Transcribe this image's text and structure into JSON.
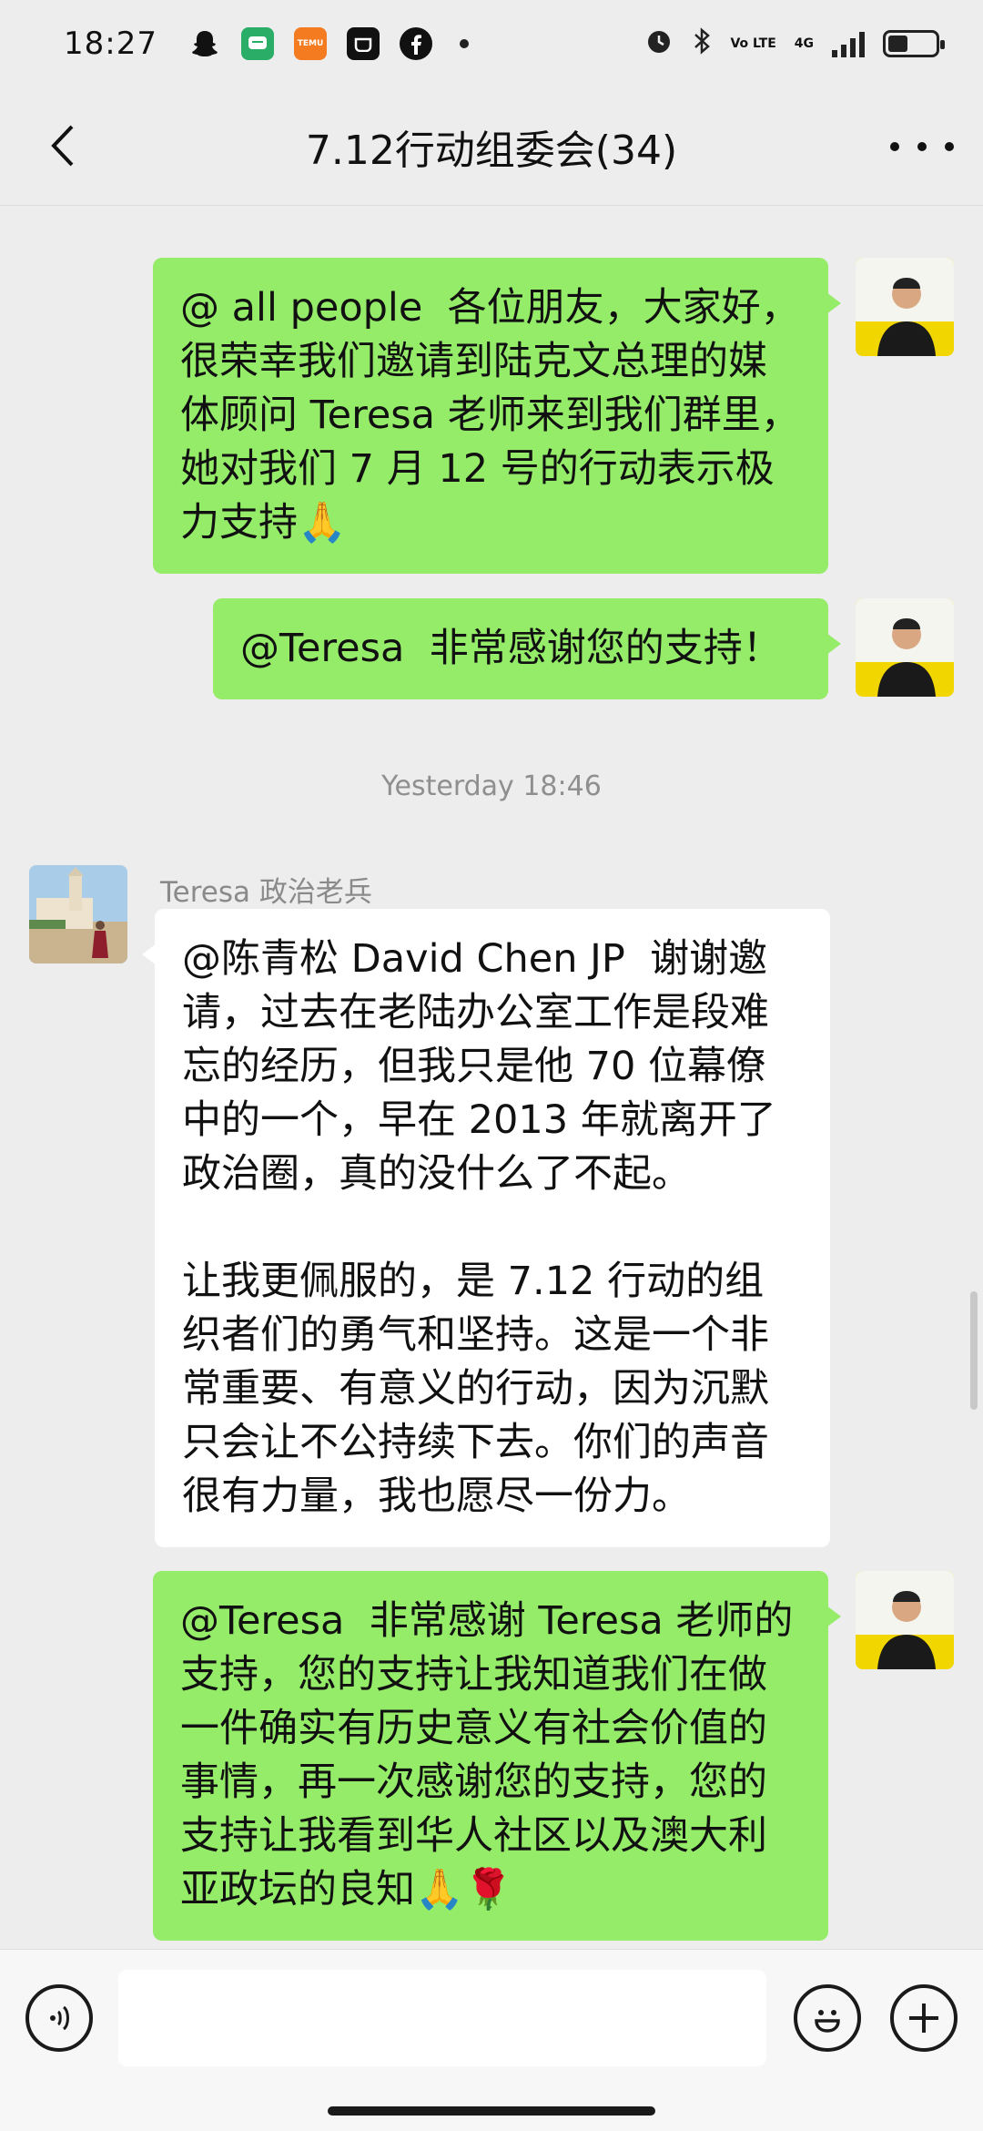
{
  "status_bar": {
    "time": "18:27",
    "apps": [
      "snapchat-icon",
      "wechat-icon",
      "temu-icon",
      "app-box-icon",
      "facebook-icon"
    ],
    "temu_label": "TEMU",
    "network": "4G",
    "volte": "Vo LTE"
  },
  "header": {
    "title": "7.12行动组委会(34)"
  },
  "messages": [
    {
      "direction": "out",
      "text": "@ all people  各位朋友，大家好，很荣幸我们邀请到陆克文总理的媒体顾问 Teresa 老师来到我们群里，她对我们 7 月 12 号的行动表示极力支持🙏"
    },
    {
      "direction": "out",
      "text": "@Teresa  非常感谢您的支持！"
    },
    {
      "type": "timestamp",
      "text": "Yesterday 18:46"
    },
    {
      "direction": "in",
      "sender": "Teresa 政治老兵",
      "text": "@陈青松 David Chen JP  谢谢邀请，过去在老陆办公室工作是段难忘的经历，但我只是他 70 位幕僚中的一个，早在 2013 年就离开了政治圈，真的没什么了不起。\n\n让我更佩服的，是 7.12 行动的组织者们的勇气和坚持。这是一个非常重要、有意义的行动，因为沉默只会让不公持续下去。你们的声音很有力量，我也愿尽一份力。"
    },
    {
      "direction": "out",
      "text": "@Teresa  非常感谢 Teresa 老师的支持，您的支持让我知道我们在做一件确实有历史意义有社会价值的事情，再一次感谢您的支持，您的支持让我看到华人社区以及澳大利亚政坛的良知🙏🌹"
    }
  ],
  "input": {
    "value": "",
    "placeholder": ""
  },
  "colors": {
    "outgoing_bubble": "#95ec69",
    "incoming_bubble": "#ffffff",
    "background": "#ededed"
  }
}
